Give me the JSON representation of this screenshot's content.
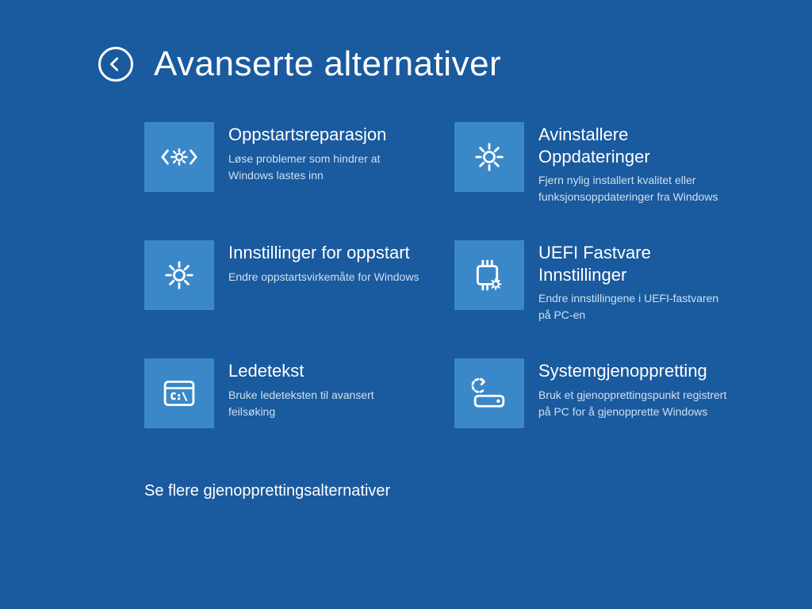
{
  "colors": {
    "background": "#1a5a9e",
    "tile": "#3b88c8",
    "text": "#ffffff",
    "desc": "#cde0f2"
  },
  "header": {
    "title": "Avanserte alternativer"
  },
  "tiles": [
    {
      "id": "startup-repair",
      "title": "Oppstartsreparasjon",
      "desc": "Løse problemer som hindrer at Windows lastes inn",
      "icon": "gear-brackets-icon"
    },
    {
      "id": "uninstall-updates",
      "title": "Avinstallere Oppdateringer",
      "desc": "Fjern nylig installert kvalitet eller funksjonsoppdateringer fra Windows",
      "icon": "gear-icon"
    },
    {
      "id": "startup-settings",
      "title": "Innstillinger for oppstart",
      "desc": "Endre oppstartsvirkemåte for Windows",
      "icon": "gear-icon"
    },
    {
      "id": "uefi-firmware",
      "title": "UEFI  Fastvare Innstillinger",
      "desc": "Endre innstillingene i UEFI-fastvaren på PC-en",
      "icon": "chip-gear-icon"
    },
    {
      "id": "command-prompt",
      "title": "Ledetekst",
      "desc": "Bruke ledeteksten til avansert feilsøking",
      "icon": "terminal-icon"
    },
    {
      "id": "system-restore",
      "title": "Systemgjenoppretting",
      "desc": "Bruk et gjenopprettingspunkt registrert på PC for å gjenopprette Windows",
      "icon": "restore-icon"
    }
  ],
  "moreLink": "Se flere gjenopprettingsalternativer"
}
